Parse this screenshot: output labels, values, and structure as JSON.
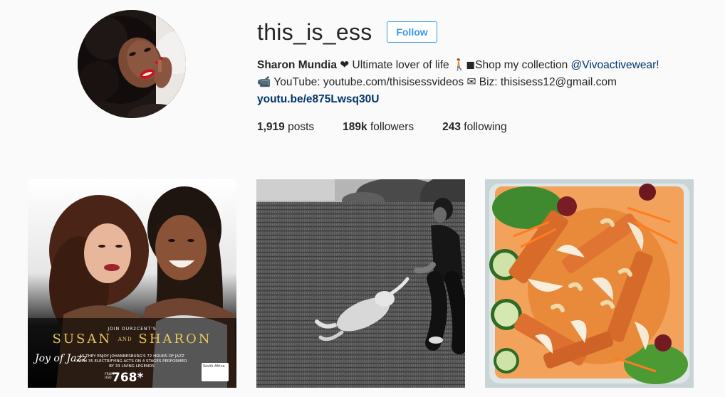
{
  "profile": {
    "username": "this_is_ess",
    "follow_label": "Follow",
    "bio": {
      "name": "Sharon Mundia",
      "line1_text": " ❤ Ultimate lover of life 🚶◼Shop my collection ",
      "mention": "@Vivoactivewear!",
      "line2_text": "📹 YouTube: youtube.com/thisisessvideos ✉ Biz: thisisess12@gmail.com",
      "link": "youtu.be/e875Lwsq30U"
    },
    "stats": {
      "posts_count": "1,919",
      "posts_label": " posts",
      "followers_count": "189k",
      "followers_label": " followers",
      "following_count": "243",
      "following_label": " following"
    }
  },
  "posts": [
    {
      "kind": "event-poster",
      "join_text": "JOIN OUR2CENT'S",
      "title_left": "SUSAN",
      "title_and": "AND",
      "title_right": "SHARON",
      "subtitle": "AS THEY ENJOY JOHANNESBURG'S 72 HOURS OF JAZZ WITH 35 ELECTRIFYING ACTS ON 4 STAGES PERFORMED BY 33 LIVING LEGENDS",
      "price_prefix": "FROM USD",
      "price": "768*",
      "festival_logo": "Joy of Jazz",
      "sponsor_logo": "South Africa"
    },
    {
      "kind": "photo",
      "subject": "woman-with-dog-on-lawn"
    },
    {
      "kind": "photo",
      "subject": "chicken-salad-bowl"
    }
  ],
  "colors": {
    "accent": "#3897f0",
    "link": "#003569",
    "background": "#fafafa",
    "text": "#262626",
    "poster_gold": "#e7c55a"
  }
}
